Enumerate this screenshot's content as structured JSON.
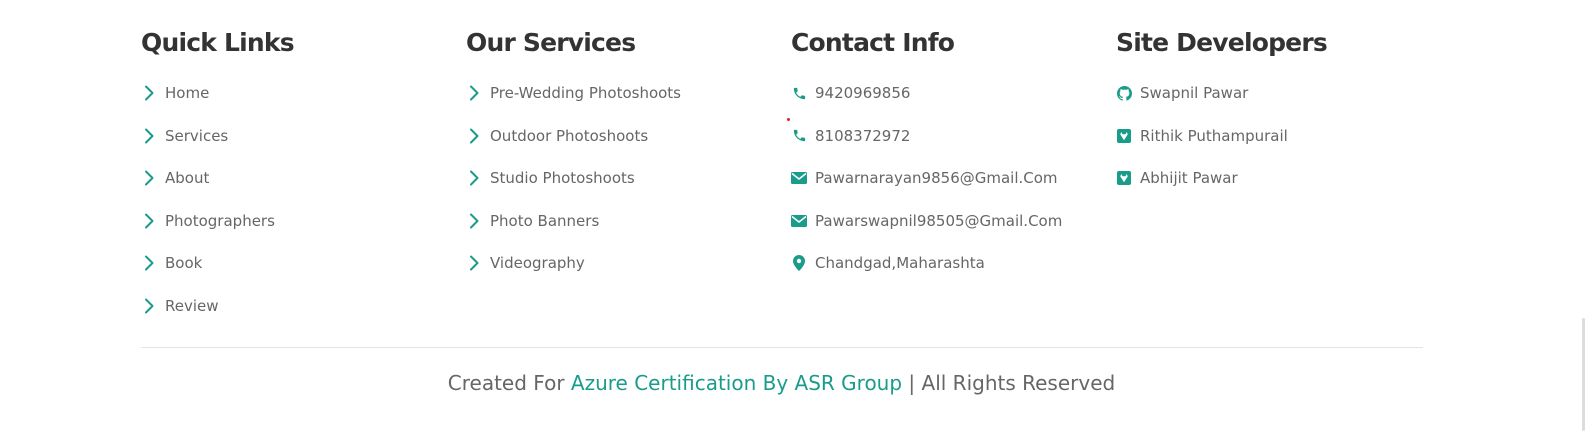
{
  "colors": {
    "accent": "#1a9c8a",
    "heading": "#333333",
    "text": "#666666",
    "divider": "#e3e3e3"
  },
  "quick_links": {
    "title": "Quick Links",
    "icon": "chevron-right-icon",
    "items": [
      "Home",
      "Services",
      "About",
      "Photographers",
      "Book",
      "Review"
    ]
  },
  "services": {
    "title": "Our Services",
    "icon": "chevron-right-icon",
    "items": [
      "Pre-Wedding Photoshoots",
      "Outdoor Photoshoots",
      "Studio Photoshoots",
      "Photo Banners",
      "Videography"
    ]
  },
  "contact": {
    "title": "Contact Info",
    "items": [
      {
        "icon": "phone-icon",
        "text": "9420969856"
      },
      {
        "icon": "phone-icon",
        "text": "8108372972"
      },
      {
        "icon": "envelope-icon",
        "text": "Pawarnarayan9856@Gmail.Com"
      },
      {
        "icon": "envelope-icon",
        "text": "Pawarswapnil98505@Gmail.Com"
      },
      {
        "icon": "map-marker-icon",
        "text": "Chandgad,Maharashta"
      }
    ]
  },
  "developers": {
    "title": "Site Developers",
    "items": [
      {
        "icon": "github-icon",
        "text": "Swapnil Pawar"
      },
      {
        "icon": "gitlab-square-icon",
        "text": "Rithik Puthampurail"
      },
      {
        "icon": "gitlab-square-icon",
        "text": "Abhijit Pawar"
      }
    ]
  },
  "footer": {
    "prefix": "Created For",
    "link": "Azure Certification By ASR Group",
    "suffix": "| All Rights Reserved"
  }
}
